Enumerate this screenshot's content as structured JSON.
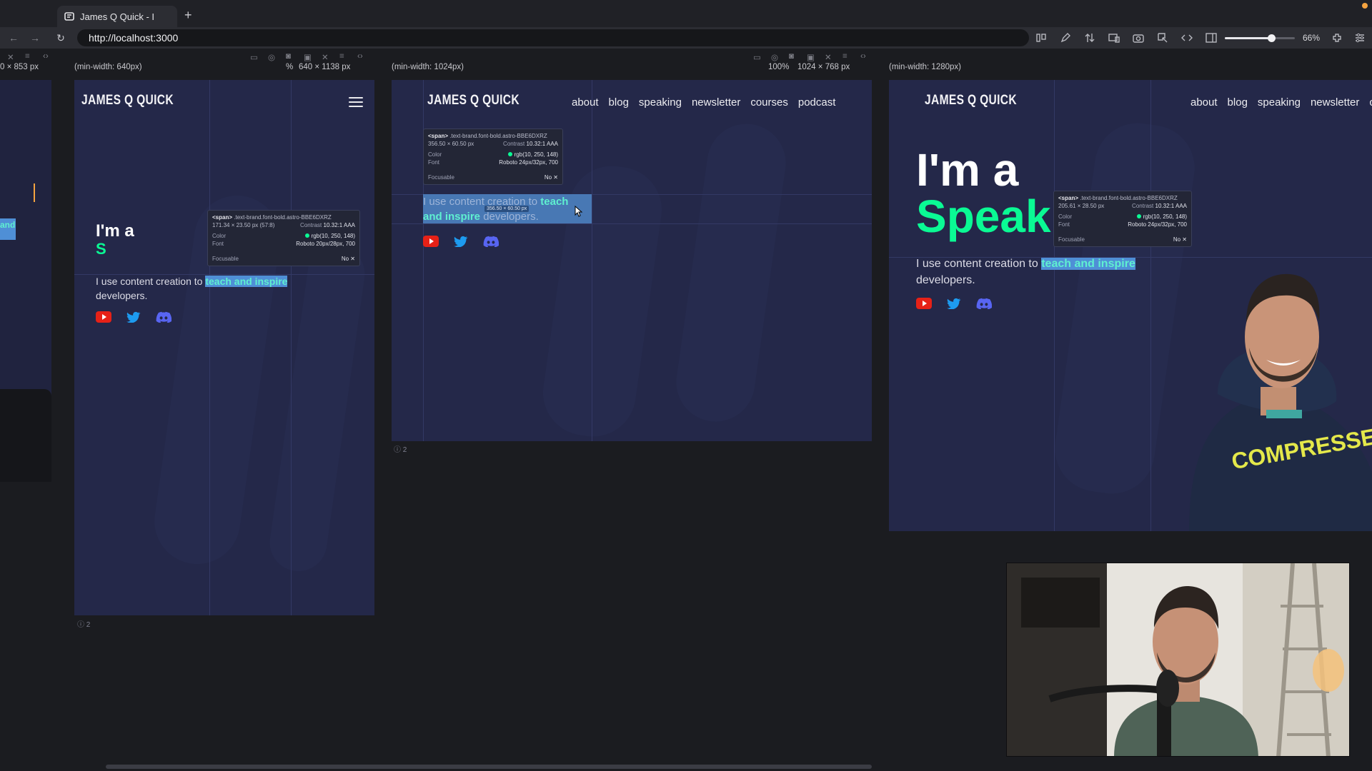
{
  "browser": {
    "tab_title": "James Q Quick - I",
    "new_tab": "+",
    "url": "http://localhost:3000",
    "zoom_level": "66%",
    "zoom_fraction": 0.66
  },
  "panes": [
    {
      "query": "(min-width: 640px)",
      "zoom": "%",
      "size": "640 × 1138 px",
      "badge": "ⓘ 2"
    },
    {
      "query": "(min-width: 1024px)",
      "zoom": "100%",
      "size": "1024 × 768 px",
      "badge": "ⓘ 2"
    },
    {
      "query": "(min-width: 1280px)",
      "zoom": "",
      "size": "",
      "badge": ""
    }
  ],
  "left_pane_size": "0 × 853 px",
  "left_pane_word": "and",
  "site": {
    "logo": "JAMES Q QUICK",
    "nav": [
      "about",
      "blog",
      "speaking",
      "newsletter",
      "courses",
      "podcast"
    ],
    "nav_1280": [
      "about",
      "blog",
      "speaking",
      "newsletter",
      "c"
    ],
    "hero_line1": "I'm a",
    "hero_accent_small": "S",
    "hero_accent_large": "Speak",
    "lead_before": "I use content creation to ",
    "lead_highlight": "teach and inspire",
    "lead_after": " developers.",
    "lead_1024_line1": "I use content creation to ",
    "lead_1024_hl1": "teach",
    "lead_1024_hl2": "and inspire",
    "lead_1024_after": " developers.",
    "socials": [
      "youtube",
      "twitter",
      "discord"
    ],
    "hoodie_text": "COMPRESSED"
  },
  "inspector": [
    {
      "tag": "<span>",
      "cls": ".text-brand.font-bold.astro-BBE6DXRZ",
      "size": "171.34 × 23.50 px (57:8)",
      "contrast_label": "Contrast",
      "contrast": "10.32:1 AAA",
      "color_label": "Color",
      "color": "rgb(10, 250, 148)",
      "font_label": "Font",
      "font": "Roboto 20px/28px, 700",
      "focus_label": "Focusable",
      "focus": "No"
    },
    {
      "tag": "<span>",
      "cls": ".text-brand.font-bold.astro-BBE6DXRZ",
      "size": "356.50 × 60.50 px",
      "contrast_label": "Contrast",
      "contrast": "10.32:1 AAA",
      "color_label": "Color",
      "color": "rgb(10, 250, 148)",
      "font_label": "Font",
      "font": "Roboto 24px/32px, 700",
      "focus_label": "Focusable",
      "focus": "No"
    },
    {
      "tag": "<span>",
      "cls": ".text-brand.font-bold.astro-BBE6DXRZ",
      "size": "205.61 × 28.50 px",
      "contrast_label": "Contrast",
      "contrast": "10.32:1 AAA",
      "color_label": "Color",
      "color": "rgb(10, 250, 148)",
      "font_label": "Font",
      "font": "Roboto 24px/32px, 700",
      "focus_label": "Focusable",
      "focus": "No"
    }
  ],
  "selection_size": "356.50 × 60.50 px",
  "colors": {
    "brand": "#0afa94",
    "site_bg": "#242849",
    "youtube": "#e62117",
    "twitter": "#1d9bf0",
    "discord": "#5865f2"
  }
}
